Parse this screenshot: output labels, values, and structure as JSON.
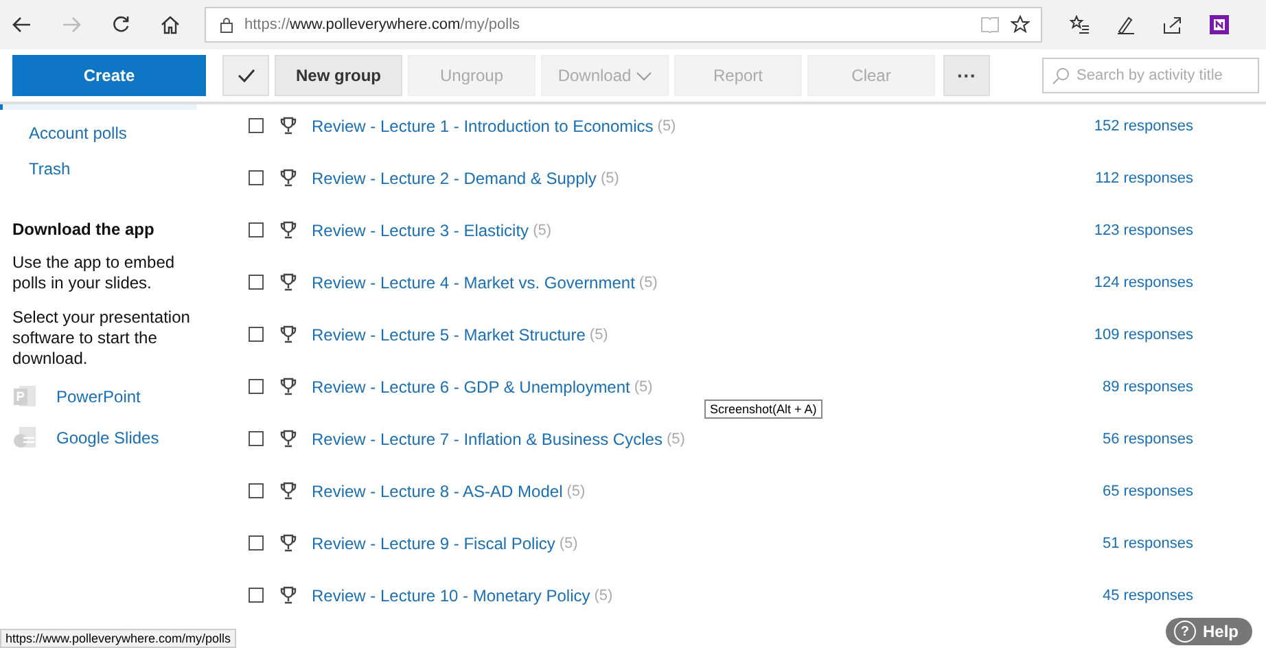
{
  "browser": {
    "url_prefix": "https://",
    "url_domain": "www.polleverywhere.com",
    "url_path": "/my/polls",
    "forward_disabled": true
  },
  "toolbar": {
    "create": "Create",
    "buttons": [
      {
        "label": "New group",
        "disabled": false,
        "dropdown": false
      },
      {
        "label": "Ungroup",
        "disabled": true,
        "dropdown": false
      },
      {
        "label": "Download",
        "disabled": true,
        "dropdown": true
      },
      {
        "label": "Report",
        "disabled": true,
        "dropdown": false
      },
      {
        "label": "Clear",
        "disabled": true,
        "dropdown": false
      }
    ],
    "more": "···",
    "search_placeholder": "Search by activity title"
  },
  "sidebar": {
    "items": [
      {
        "label": "Account polls"
      },
      {
        "label": "Trash"
      }
    ],
    "download_title": "Download the app",
    "download_text": "Use the app to embed polls in your slides.",
    "select_text": "Select your presentation software to start the download.",
    "apps": [
      {
        "label": "PowerPoint",
        "kind": "powerpoint"
      },
      {
        "label": "Google Slides",
        "kind": "slides"
      }
    ]
  },
  "polls": [
    {
      "title": "Review - Lecture 1 - Introduction to Economics",
      "count": "(5)",
      "responses": "152 responses",
      "checked": false
    },
    {
      "title": "Review - Lecture 2 - Demand & Supply",
      "count": "(5)",
      "responses": "112 responses",
      "checked": false
    },
    {
      "title": "Review - Lecture 3 - Elasticity",
      "count": "(5)",
      "responses": "123 responses",
      "checked": false
    },
    {
      "title": "Review - Lecture 4 - Market vs. Government",
      "count": "(5)",
      "responses": "124 responses",
      "checked": false
    },
    {
      "title": "Review - Lecture 5 - Market Structure",
      "count": "(5)",
      "responses": "109 responses",
      "checked": false
    },
    {
      "title": "Review - Lecture 6 - GDP & Unemployment",
      "count": "(5)",
      "responses": "89 responses",
      "checked": false
    },
    {
      "title": "Review - Lecture 7 - Inflation & Business Cycles",
      "count": "(5)",
      "responses": "56 responses",
      "checked": false
    },
    {
      "title": "Review - Lecture 8 - AS-AD Model",
      "count": "(5)",
      "responses": "65 responses",
      "checked": false
    },
    {
      "title": "Review - Lecture 9 - Fiscal Policy",
      "count": "(5)",
      "responses": "51 responses",
      "checked": false
    },
    {
      "title": "Review - Lecture 10 - Monetary Policy",
      "count": "(5)",
      "responses": "45 responses",
      "checked": false
    }
  ],
  "tooltip": "Screenshot(Alt + A)",
  "status_url": "https://www.polleverywhere.com/my/polls",
  "help": "Help",
  "help_mark": "?"
}
